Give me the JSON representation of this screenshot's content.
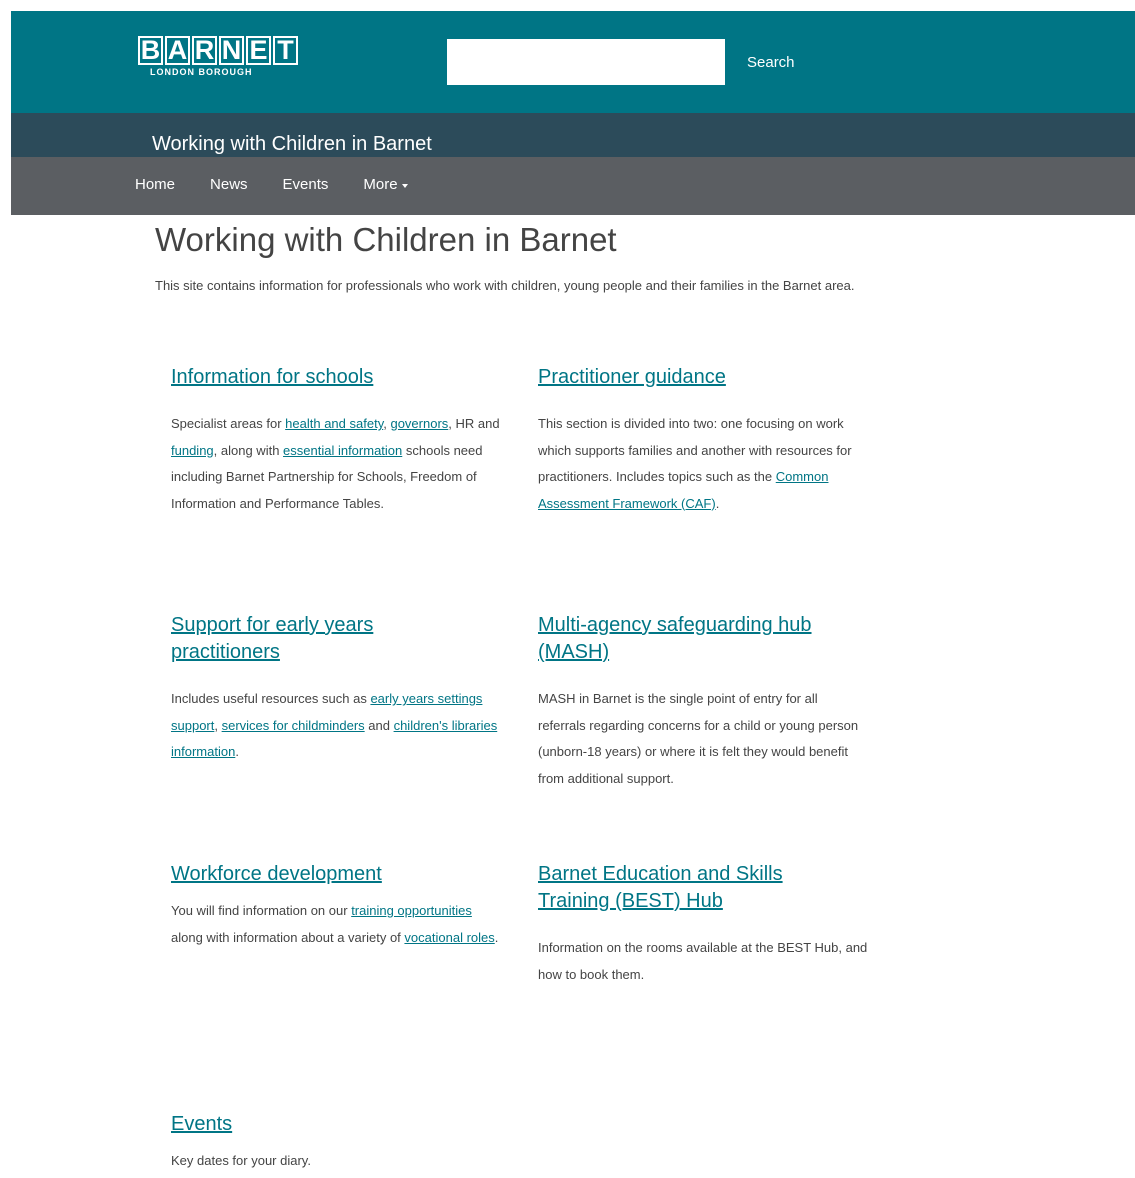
{
  "header": {
    "logo_letters": [
      "B",
      "A",
      "R",
      "N",
      "E",
      "T"
    ],
    "logo_sub": "LONDON BOROUGH",
    "search_placeholder": "",
    "search_label": "Search",
    "site_title": "Working with Children in Barnet"
  },
  "nav": {
    "items": [
      "Home",
      "News",
      "Events",
      "More"
    ]
  },
  "main": {
    "title": "Working with Children in Barnet",
    "intro": "This site contains information for professionals who work with children, young people and their families in the Barnet area."
  },
  "cards": [
    {
      "title": "Information for schools",
      "parts": [
        {
          "t": "Specialist areas for "
        },
        {
          "t": "health and safety",
          "link": true
        },
        {
          "t": ", "
        },
        {
          "t": "governors",
          "link": true
        },
        {
          "t": ", HR and "
        },
        {
          "t": "funding",
          "link": true
        },
        {
          "t": ", along with "
        },
        {
          "t": "essential information",
          "link": true
        },
        {
          "t": " schools need including Barnet Partnership for Schools, Freedom of Information and Performance Tables."
        }
      ]
    },
    {
      "title": "Practitioner guidance",
      "parts": [
        {
          "t": "This section is divided into two: one focusing on work which supports families and another with resources for practitioners. Includes topics such as the "
        },
        {
          "t": "Common Assessment Framework (CAF)",
          "link": true
        },
        {
          "t": "."
        }
      ]
    },
    {
      "title": "Support for early years practitioners",
      "parts": [
        {
          "t": "Includes useful resources such as "
        },
        {
          "t": "early years settings support",
          "link": true
        },
        {
          "t": ", "
        },
        {
          "t": "services for childminders",
          "link": true
        },
        {
          "t": " and "
        },
        {
          "t": "children's libraries information",
          "link": true
        },
        {
          "t": "."
        }
      ]
    },
    {
      "title": "Multi-agency safeguarding hub (MASH)",
      "parts": [
        {
          "t": "MASH in Barnet is the single point of entry for all referrals regarding concerns for a child or young person (unborn-18 years) or where it is felt they would benefit from additional support."
        }
      ]
    },
    {
      "title": "Workforce development",
      "parts": [
        {
          "t": "You will find information on our "
        },
        {
          "t": "training opportunities",
          "link": true
        },
        {
          "t": " along with information about a variety of "
        },
        {
          "t": "vocational roles",
          "link": true
        },
        {
          "t": "."
        }
      ]
    },
    {
      "title": "Barnet Education and Skills Training (BEST) Hub",
      "parts": [
        {
          "t": "Information on the rooms available at the BEST Hub, and how to book them."
        }
      ]
    },
    {
      "title": "Events",
      "parts": [
        {
          "t": "Key dates for your diary."
        }
      ]
    }
  ],
  "colors": {
    "topbar": "#007585",
    "sitebar": "#2c4b5a",
    "navbar": "#5b5e62",
    "link": "#007585"
  }
}
